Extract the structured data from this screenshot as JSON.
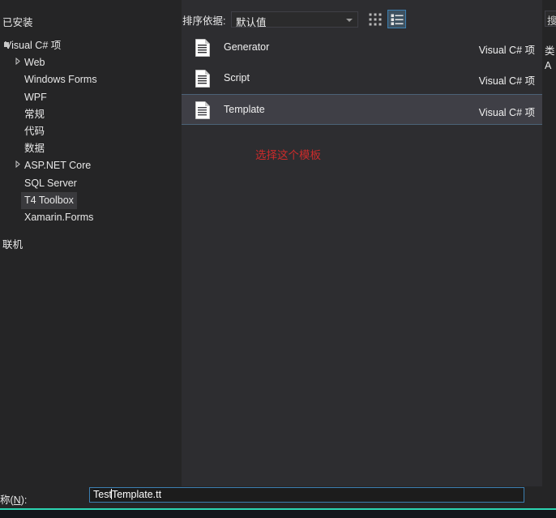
{
  "colors": {
    "accent_blue": "#3c7fb1",
    "annotation_red": "#cc2b2b",
    "teal_rule": "#2cd5b2",
    "panel_bg": "#252526",
    "list_bg": "#2d2d30",
    "selected_row": "#3f3f46"
  },
  "left_panel": {
    "installed_header": "已安装",
    "online_header": "联机",
    "tree": [
      {
        "label": "Visual C# 项",
        "depth": 0,
        "arrow": "expanded",
        "selected": false
      },
      {
        "label": "Web",
        "depth": 1,
        "arrow": "collapsed",
        "selected": false
      },
      {
        "label": "Windows Forms",
        "depth": 1,
        "arrow": "none",
        "selected": false
      },
      {
        "label": "WPF",
        "depth": 1,
        "arrow": "none",
        "selected": false
      },
      {
        "label": "常规",
        "depth": 1,
        "arrow": "none",
        "selected": false
      },
      {
        "label": "代码",
        "depth": 1,
        "arrow": "none",
        "selected": false
      },
      {
        "label": "数据",
        "depth": 1,
        "arrow": "none",
        "selected": false
      },
      {
        "label": "ASP.NET Core",
        "depth": 1,
        "arrow": "collapsed",
        "selected": false
      },
      {
        "label": "SQL Server",
        "depth": 1,
        "arrow": "none",
        "selected": false
      },
      {
        "label": "T4 Toolbox",
        "depth": 1,
        "arrow": "none",
        "selected": true
      },
      {
        "label": "Xamarin.Forms",
        "depth": 1,
        "arrow": "none",
        "selected": false
      }
    ]
  },
  "toolbar": {
    "sort_label": "排序依据:",
    "sort_value": "默认值",
    "tiles_view_icon": "grid-view-icon",
    "list_view_icon": "list-view-icon",
    "list_view_selected": true
  },
  "item_list": {
    "items": [
      {
        "title": "Generator",
        "kind": "Visual C# 项",
        "icon": "document-icon",
        "selected": false
      },
      {
        "title": "Script",
        "kind": "Visual C# 项",
        "icon": "document-icon",
        "selected": false
      },
      {
        "title": "Template",
        "kind": "Visual C# 项",
        "icon": "document-icon",
        "selected": true
      }
    ]
  },
  "annotation": {
    "text": "选择这个模板"
  },
  "right_panel": {
    "search_placeholder": "搜索",
    "line1": "类",
    "line2": "A"
  },
  "bottom": {
    "name_label_prefix": "称(",
    "name_label_key": "N",
    "name_label_suffix": "):",
    "name_value_before_caret": "Test",
    "name_value_after_caret": "Template.tt",
    "name_value_full": "TestTemplate.tt"
  }
}
